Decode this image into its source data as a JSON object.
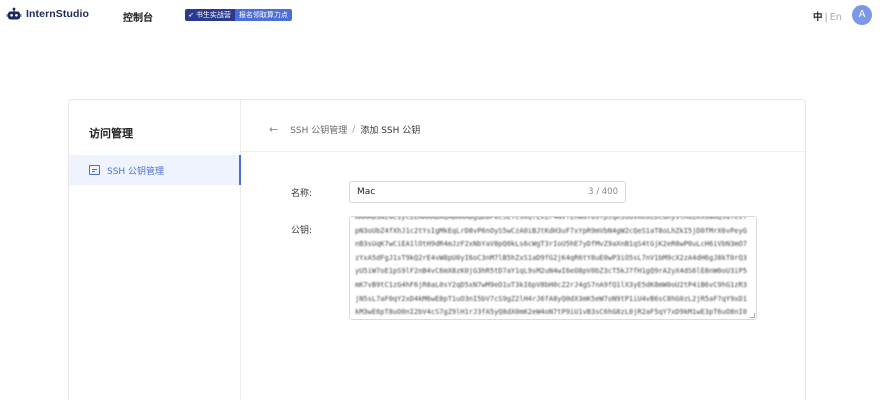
{
  "header": {
    "brand": "InternStudio",
    "nav_console": "控制台",
    "promo_left": "书生实战营",
    "promo_right": "报名领取算力点",
    "lang_current": "中",
    "lang_sep": "|",
    "lang_alt": "En",
    "avatar_initial": "A"
  },
  "sidebar": {
    "title": "访问管理",
    "items": [
      {
        "label": "SSH 公钥管理"
      }
    ]
  },
  "breadcrumb": {
    "parent": "SSH 公钥管理",
    "separator": "/",
    "current": "添加 SSH 公钥"
  },
  "form": {
    "name_label": "名称:",
    "name_value": "Mac",
    "name_count": "3 / 400",
    "key_label": "公钥:",
    "key_value": "AAAAB3NzaC1yc2EAAAADAQABAAABgQDBP8c5ETc9kQ7LxZr4NVf2hWmY8sTpJqK3uGvAe6LbCaRy9lHd2Kx0WmQ5aTeV7pN3oUbZ4fXhJ1c2tYsIgMkEqLrD8vP6nOyS5wCzA0iBJtKdH3uF7xYpR9mVbN4gW2cQeS1aT8oLhZkI5jD0fMrX6vPeyGnB3sUqK7wCiEA1lOtH9dR4mJzF2xNbYaV8pQ0kLs6cWgT3rIoU5hE7yDfMvZ9aXnB1qS4tGjK2eR8wP0uLcH6iVbN3mO7zYxA5dFgJ1sT9kQ2rE4vW8pU0yI6oC3nM7lB5hZxS1aD9fG2jK4qR6tY8uE0wP3iO5sL7nV1bM9cX2zA4dH6gJ8kT0rQ3yU5iW7oE1pS9lF2nB4vC6mX8zK0jG3hR5tD7aY1qL9sM2uN4wI6eO8pV0bZ3cT5kJ7fH1gQ9rA2yX4dS6lE8nW0oU3iP5mK7vB9tC1zG4hF6jR8aL0sY2qD5xN7wM9eO1uT3kI6pV8bH0cZ2rJ4gS7nA9fQ1lX3yE5dK8mW0oU2tP4iB6vC9hG1zR3jN5sL7aF0qY2xD4kM6wE8pT1uO3nI5bV7cS9gZ2lH4rJ6fA8yQ0dX3mK5eW7oN9tP1iU4vB6sC8hG0zL2jR5aF7qY9xD1kM3wE6pT8uO0nI2bV4cS7gZ9lH1rJ3fA5yQ8dX0mK2eW4oN7tP9iU1vB3sC6hG8zL0jR2aF5qY7xD9kM1wE3pT6uO8nI0bV2cS5gZ7lH9rJ1fA3yQ6dX8mK0eW2oN5tP7iU9vB1sC3hG6zL8jR0aF2qY5xD7kM9wE1pT3uO6nI8bV0cS2gZ5lH7rJ9fA1yQ3dX6mK8eW0oN2tP5iU7vB9 user@user-MacBook-Air.local"
  }
}
